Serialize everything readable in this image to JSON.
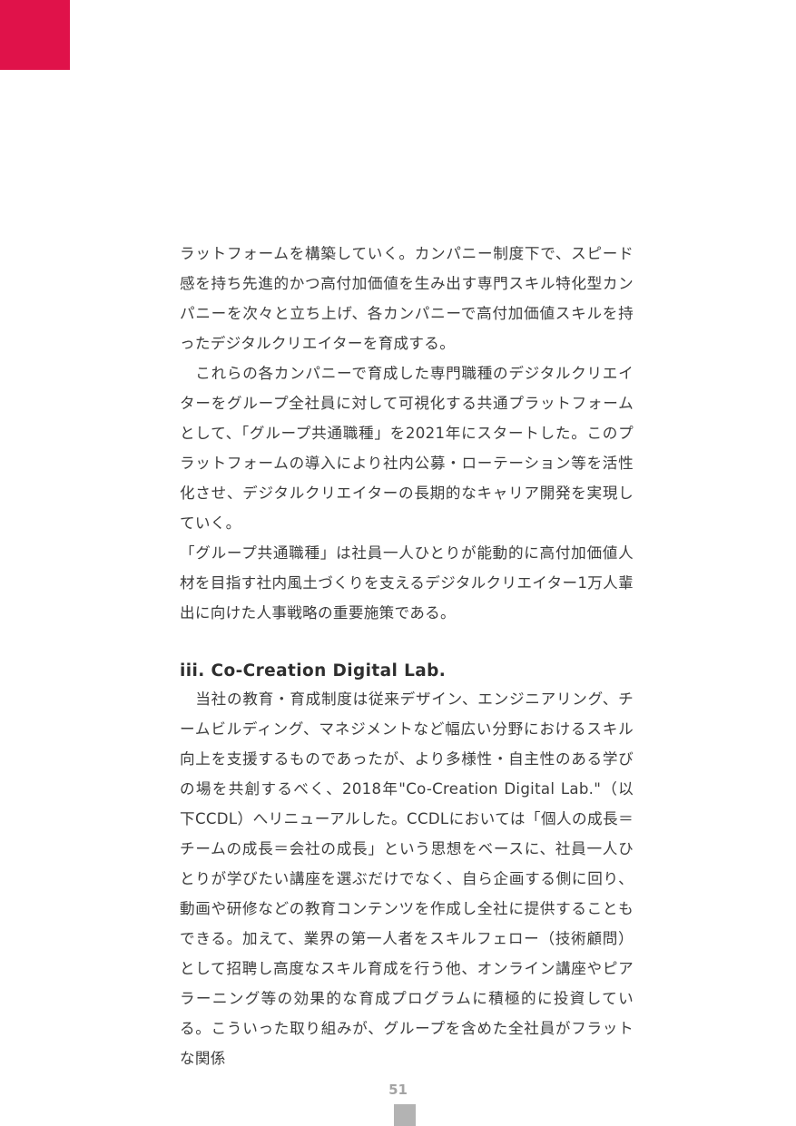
{
  "paragraphs_top": [
    "ラットフォームを構築していく。カンパニー制度下で、スピード感を持ち先進的かつ高付加価値を生み出す専門スキル特化型カンパニーを次々と立ち上げ、各カンパニーで高付加価値スキルを持ったデジタルクリエイターを育成する。",
    "　これらの各カンパニーで育成した専門職種のデジタルクリエイターをグループ全社員に対して可視化する共通プラットフォームとして、「グループ共通職種」を2021年にスタートした。このプラットフォームの導入により社内公募・ローテーション等を活性化させ、デジタルクリエイターの長期的なキャリア開発を実現していく。",
    "「グループ共通職種」は社員一人ひとりが能動的に高付加価値人材を目指す社内風土づくりを支えるデジタルクリエイター1万人輩出に向けた人事戦略の重要施策である。"
  ],
  "section": {
    "heading": "iii. Co-Creation Digital Lab.",
    "body": "　当社の教育・育成制度は従来デザイン、エンジニアリング、チームビルディング、マネジメントなど幅広い分野におけるスキル向上を支援するものであったが、より多様性・自主性のある学びの場を共創するべく、2018年\"Co-Creation Digital Lab.\"（以下CCDL）へリニューアルした。CCDLにおいては「個人の成長＝チームの成長＝会社の成長」という思想をベースに、社員一人ひとりが学びたい講座を選ぶだけでなく、自ら企画する側に回り、動画や研修などの教育コンテンツを作成し全社に提供することもできる。加えて、業界の第一人者をスキルフェロー（技術顧問）として招聘し高度なスキル育成を行う他、オンライン講座やピアラーニング等の効果的な育成プログラムに積極的に投資している。こういった取り組みが、グループを含めた全社員がフラットな関係"
  },
  "page_number": "51",
  "colors": {
    "accent": "#e0124a",
    "page_tab": "#b3b3b3",
    "text": "#3d3d3d"
  }
}
